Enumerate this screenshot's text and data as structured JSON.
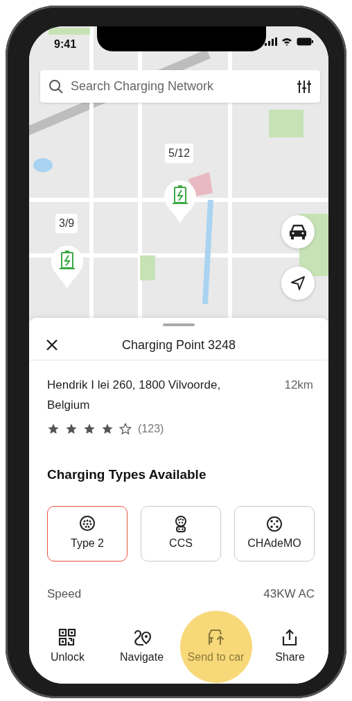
{
  "status_bar": {
    "time": "9:41"
  },
  "search": {
    "placeholder": "Search Charging Network"
  },
  "map_pins": [
    {
      "count": "5/12"
    },
    {
      "count": "3/9"
    }
  ],
  "sheet": {
    "title": "Charging Point 3248",
    "address": "Hendrik I lei 260, 1800 Vilvoorde, Belgium",
    "distance": "12km",
    "stars": 4,
    "review_count": "(123)",
    "section_title": "Charging Types Available",
    "charging_types": [
      {
        "label": "Type 2",
        "selected": true,
        "kind": "type2"
      },
      {
        "label": "CCS",
        "selected": false,
        "kind": "ccs"
      },
      {
        "label": "CHAdeMO",
        "selected": false,
        "kind": "chademo"
      }
    ],
    "details": [
      {
        "label": "Speed",
        "value": "43KW AC"
      }
    ]
  },
  "actions": [
    {
      "label": "Unlock",
      "kind": "unlock",
      "highlighted": false
    },
    {
      "label": "Navigate",
      "kind": "navigate",
      "highlighted": false
    },
    {
      "label": "Send to car",
      "kind": "send",
      "highlighted": true
    },
    {
      "label": "Share",
      "kind": "share",
      "highlighted": false
    }
  ]
}
